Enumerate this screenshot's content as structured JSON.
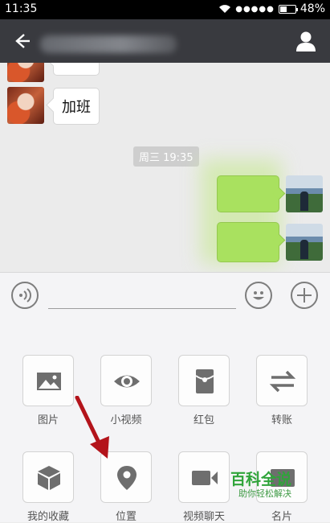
{
  "status_bar": {
    "time": "11:35",
    "signal": "●●●●●",
    "battery": "48%"
  },
  "chat": {
    "messages": [
      {
        "side": "left",
        "text": ""
      },
      {
        "side": "left",
        "text": "加班"
      },
      {
        "side": "right",
        "text": ""
      },
      {
        "side": "right",
        "text": ""
      }
    ],
    "timestamp": "周三 19:35"
  },
  "panel": {
    "items": [
      {
        "label": "图片",
        "icon": "image-icon"
      },
      {
        "label": "小视频",
        "icon": "eye-icon"
      },
      {
        "label": "红包",
        "icon": "red-packet-icon"
      },
      {
        "label": "转账",
        "icon": "transfer-icon"
      },
      {
        "label": "我的收藏",
        "icon": "cube-icon"
      },
      {
        "label": "位置",
        "icon": "location-pin-icon"
      },
      {
        "label": "视频聊天",
        "icon": "video-camera-icon"
      },
      {
        "label": "名片",
        "icon": "contact-card-icon"
      }
    ]
  },
  "watermark": {
    "title": "百科全说",
    "subtitle": "助你轻松解决"
  },
  "colors": {
    "header_bg": "#393a3f",
    "bubble_green": "#a9e15f",
    "arrow_red": "#b3141b",
    "watermark_green": "#2fa43a"
  }
}
